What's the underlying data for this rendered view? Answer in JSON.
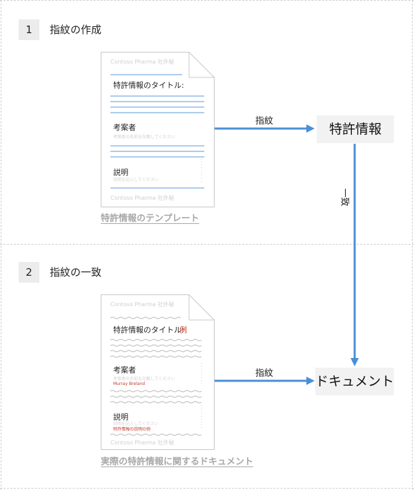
{
  "steps": [
    {
      "number": "1",
      "title": "指紋の作成"
    },
    {
      "number": "2",
      "title": "指紋の一致"
    }
  ],
  "template_doc": {
    "header_watermark": "Contoso Pharma 社外秘",
    "footer_watermark": "Contoso Pharma 社外秘",
    "title_label": "特許情報のタイトル:",
    "inventor_label": "考案者",
    "inventor_hint": "考案者の名前を記載してください",
    "description_label": "説明",
    "description_hint": "説明を記入してください",
    "caption": "特許情報のテンプレート"
  },
  "actual_doc": {
    "header_watermark": "Contoso Pharma 社外秘",
    "footer_watermark": "Contoso Pharma 社外秘",
    "title_label": "特許情報のタイトル:",
    "title_value": "例",
    "inventor_label": "考案者",
    "inventor_hint": "考案者の名前を記載してください",
    "inventor_value": "Murray Breland",
    "description_label": "説明",
    "description_hint": "説明を記入してください",
    "description_value": "特許情報の説明の例",
    "caption": "実際の特許情報に関するドキュメント"
  },
  "boxes": {
    "patent_info": "特許情報",
    "document": "ドキュメント"
  },
  "edges": {
    "fingerprint_1": "指紋",
    "fingerprint_2": "指紋",
    "match": "一致"
  },
  "colors": {
    "arrow": "#4a8fd6",
    "blue_line": "#7aaee0",
    "red_value": "#c0392b",
    "caption_gray": "#a8a8a8"
  }
}
